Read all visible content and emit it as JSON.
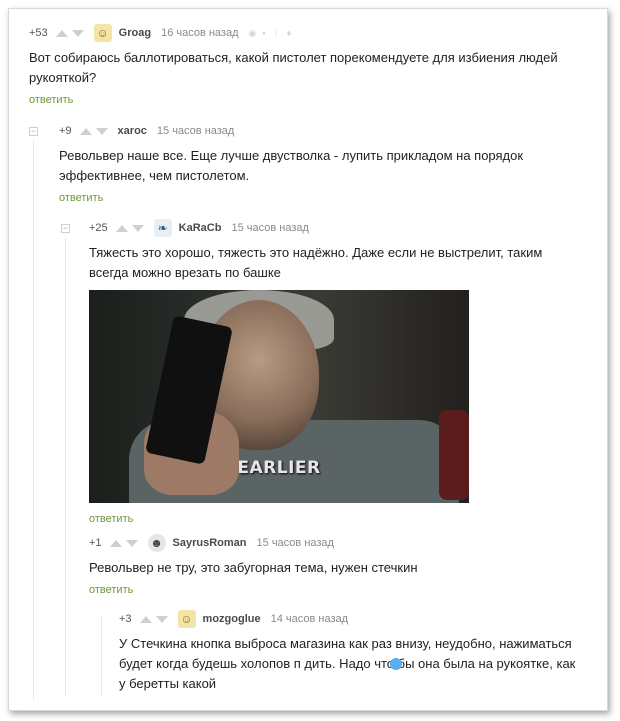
{
  "comments": [
    {
      "rating": "+53",
      "user": "Groag",
      "time": "16 часов назад",
      "text": "Вот собираюсь баллотироваться, какой пистолет порекомендуете для избиения людей рукояткой?",
      "reply": "ответить",
      "avatar_icon": "cat-avatar-icon"
    },
    {
      "rating": "+9",
      "user": "xaroc",
      "time": "15 часов назад",
      "text": "Револьвер наше все. Еще лучше двустволка - лупить прикладом на порядок эффективнее, чем пистолетом.",
      "reply": "ответить"
    },
    {
      "rating": "+25",
      "user": "KaRaCb",
      "time": "15 часов назад",
      "text": "Тяжесть это хорошо, тяжесть это надёжно. Даже если не выстрелит, таким всегда можно врезать по башке",
      "image_caption": "EARLIER",
      "reply": "ответить",
      "avatar_icon": "fish-avatar-icon"
    },
    {
      "rating": "+1",
      "user": "SayrusRoman",
      "time": "15 часов назад",
      "text": "Револьвер не тру, это забугорная тема, нужен стечкин",
      "reply": "ответить",
      "avatar_icon": "robot-avatar-icon"
    },
    {
      "rating": "+3",
      "user": "mozgoglue",
      "time": "14 часов назад",
      "text": "У Стечкина кнопка выброса магазина как раз внизу, неудобно, нажиматься будет когда будешь холопов п   дить. Надо что бы она была на рукоятке, как у беретты какой",
      "avatar_icon": "cat-avatar-icon"
    }
  ],
  "colors": {
    "reply_link": "#6a9a3a",
    "meta_text": "#8a8a8a",
    "border": "#d8d8d8"
  }
}
